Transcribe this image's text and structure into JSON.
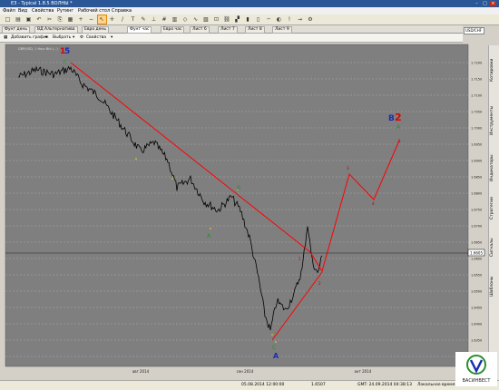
{
  "window": {
    "title": "ЕЗ - Typical 1.8.5 ВОЛНЫ *"
  },
  "menu": [
    "Файл",
    "Вид",
    "Свойства",
    "Рутинг",
    "Рабочий стол",
    "Справка"
  ],
  "toolbar": {
    "icons": [
      "new-icon",
      "open-icon",
      "save-icon",
      "undo-icon",
      "cut-icon",
      "copy-icon",
      "paste-icon",
      "zoom-in-icon",
      "zoom-out-icon",
      "cursor-icon",
      "crosshair-icon",
      "trendline-icon",
      "text-icon",
      "pencil-icon",
      "ruler-icon",
      "grid-icon",
      "calendar-icon",
      "shape-icon",
      "indicator-icon",
      "template-icon",
      "magnet-icon",
      "link-icon",
      "chart-type-icon",
      "bar-icon",
      "candle-icon",
      "line-icon",
      "color-icon",
      "alert-icon",
      "arrow-icon",
      "settings-icon"
    ]
  },
  "tabs": [
    "Фунт день",
    "ВД Альтернатива",
    "Евро день",
    "Фунт час",
    "Евро час",
    "Лист 6",
    "Лист 7",
    "Лист 8",
    "Лист 9"
  ],
  "symbol": {
    "value": "USD/CHF"
  },
  "subbar": {
    "add_chart": "Добавить график",
    "select": "Выбрать",
    "properties": "Свойства",
    "legend": "GBP/USD, 1 Hour Bid (...)"
  },
  "right_panel": [
    "Котировки",
    "Инструменты",
    "Индикаторы",
    "Стратегии",
    "Сигналы",
    "Шаблоны"
  ],
  "chart": {
    "price_label": "1.6605",
    "price_ticks": [
      "1.7200",
      "1.7150",
      "1.7100",
      "1.7050",
      "1.7000",
      "1.6950",
      "1.6900",
      "1.6850",
      "1.6800",
      "1.6750",
      "1.6700",
      "1.6650",
      "1.6600",
      "1.6550",
      "1.6500",
      "1.6450",
      "1.6400",
      "1.6350",
      "1.6300"
    ],
    "x_labels": [
      "авг 2014",
      "сен 2014",
      "окт 2014"
    ],
    "wave_labels": {
      "top_1": "1",
      "top_5": "5",
      "corr_b": "B",
      "corr_2": "2",
      "w3": "3",
      "w4": "4",
      "w5": "5",
      "sub_a": "A",
      "sub_b": "B",
      "sub_c": "C",
      "big_a": "A",
      "big_c": "C",
      "s1": "1",
      "s2": "2"
    }
  },
  "status": {
    "datetime": "05.08.2014 12:00:00",
    "price": "1.6507",
    "gmt": "GMT: 24.09.2014 04:38:13",
    "local": "Локальное время: 24"
  },
  "logo": {
    "text": "ВАСИНВЕСТ"
  },
  "colors": {
    "chart_bg": "#7f7f7f",
    "line": "#ff0000",
    "price": "#000000",
    "grid": "#c8c8c8"
  }
}
